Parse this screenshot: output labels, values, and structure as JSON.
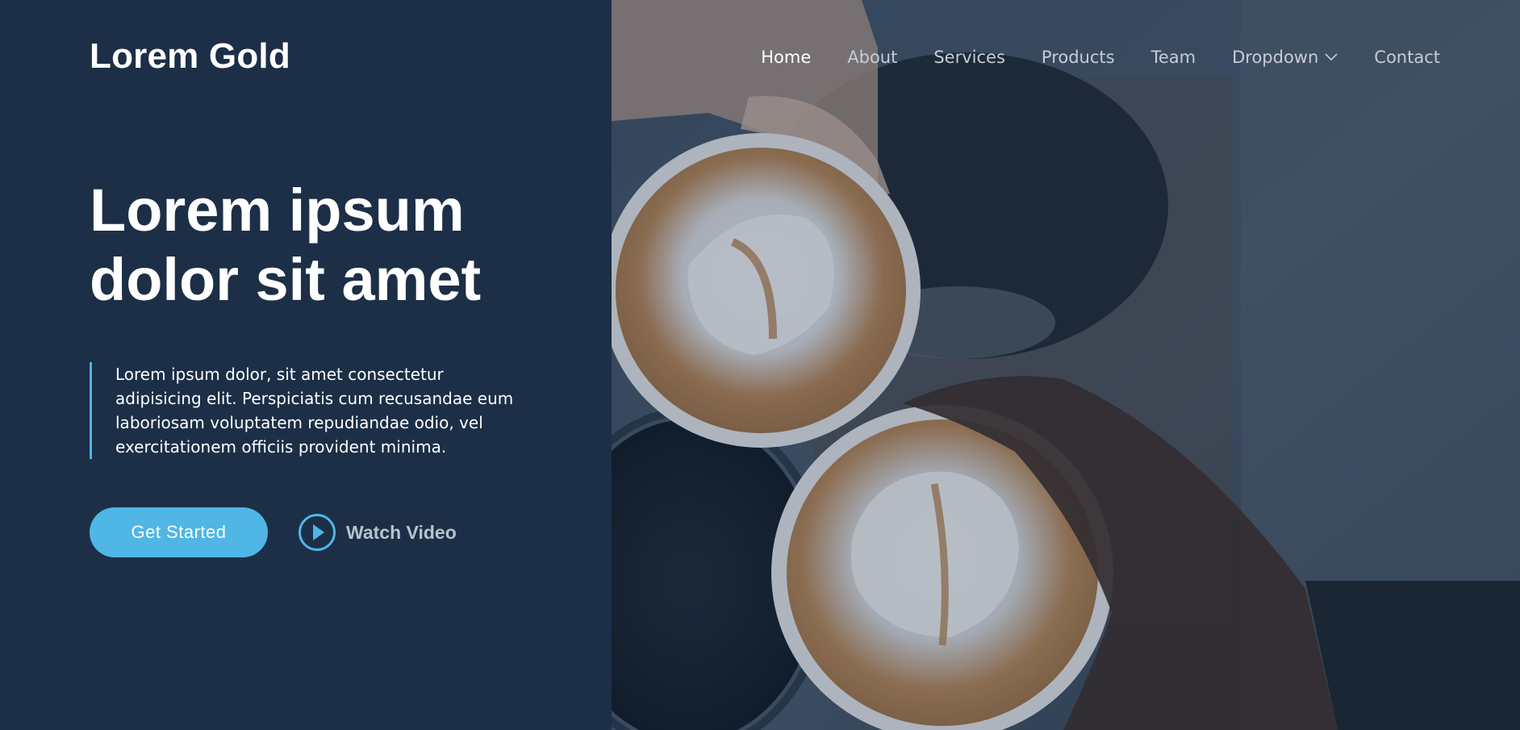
{
  "header": {
    "logo": "Lorem Gold",
    "nav": [
      {
        "label": "Home",
        "active": true
      },
      {
        "label": "About"
      },
      {
        "label": "Services"
      },
      {
        "label": "Products"
      },
      {
        "label": "Team"
      },
      {
        "label": "Dropdown",
        "icon": "chevron-down-icon"
      },
      {
        "label": "Contact"
      }
    ]
  },
  "hero": {
    "title_lines": [
      "Lorem ipsum",
      "dolor sit amet"
    ],
    "description_lines": [
      "Lorem ipsum dolor, sit amet consectetur",
      "adipisicing elit. Perspiciatis cum recusandae eum",
      "laboriosam voluptatem repudiandae odio, vel",
      "exercitationem officiis provident minima."
    ],
    "cta_label": "Get Started",
    "video_label": "Watch Video",
    "video_icon": "play-circle-icon",
    "image_subject": "coffee-cups-photo"
  },
  "colors": {
    "left_panel": "#1c2f47",
    "accent": "#4fb6e6",
    "nav_text": "#c5ccd6",
    "nav_active": "#ffffff"
  }
}
